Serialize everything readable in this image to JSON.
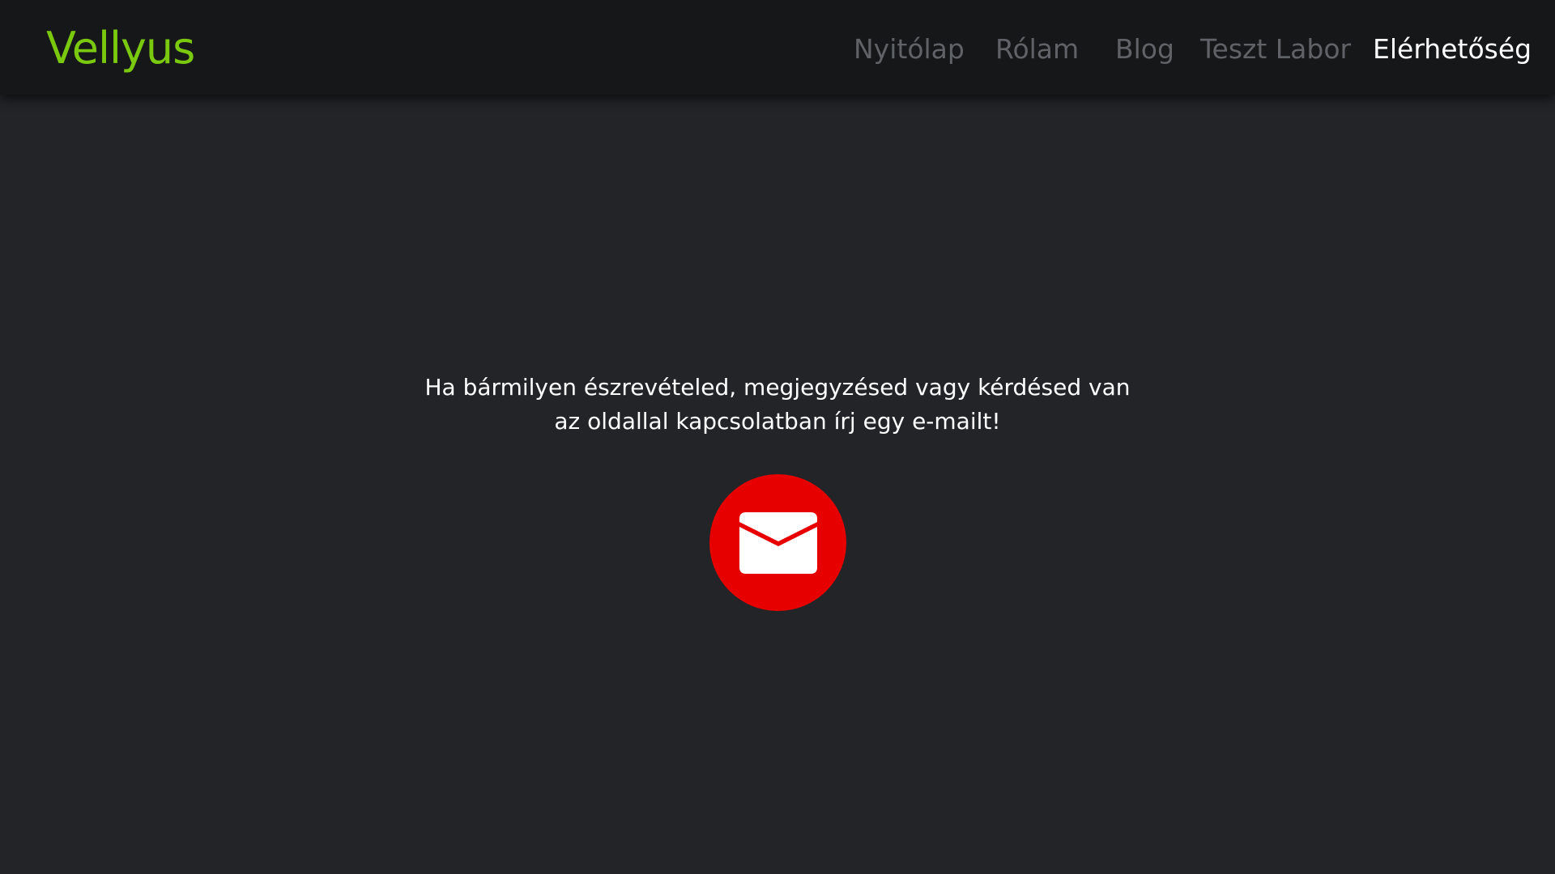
{
  "header": {
    "brand": "Vellyus",
    "nav": [
      {
        "label": "Nyitólap",
        "active": false
      },
      {
        "label": "Rólam",
        "active": false
      },
      {
        "label": "Blog",
        "active": false
      },
      {
        "label": "Teszt Labor",
        "active": false
      },
      {
        "label": "Elérhetőség",
        "active": true
      }
    ]
  },
  "main": {
    "message_line1": "Ha bármilyen észrevételed, megjegyzésed vagy kérdésed van",
    "message_line2": "az oldallal kapcsolatban írj egy e-mailt!",
    "mail_button_icon": "envelope-icon"
  },
  "colors": {
    "background": "#222427",
    "navbar": "#161718",
    "brand": "#7ac90f",
    "nav_inactive": "#5f6266",
    "nav_active": "#ffffff",
    "mail_button": "#e60000"
  }
}
